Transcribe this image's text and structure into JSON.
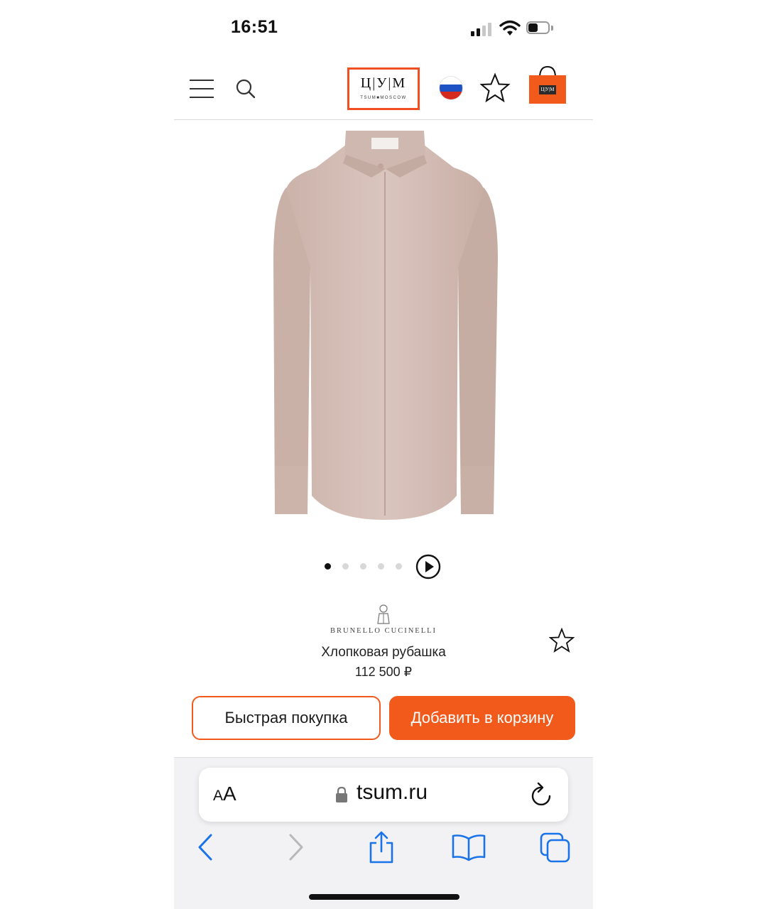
{
  "status_bar": {
    "time": "16:51"
  },
  "header": {
    "logo_main": "Ц|У|М",
    "logo_sub": "TSUM■MOSCOW",
    "bag_logo": "Ц|У|М",
    "accent_color": "#f25a1c"
  },
  "gallery": {
    "image_count": 5,
    "active_index": 0
  },
  "product": {
    "brand": "BRUNELLO CUCINELLI",
    "title": "Хлопковая рубашка",
    "price": "112 500 ₽"
  },
  "actions": {
    "quick_buy": "Быстрая покупка",
    "add_to_cart": "Добавить в корзину"
  },
  "browser": {
    "aa_small": "A",
    "aa_big": "A",
    "url": "tsum.ru"
  },
  "icons": [
    "menu-icon",
    "search-icon",
    "flag-icon",
    "star-icon",
    "bag-icon",
    "play-icon",
    "lock-icon",
    "reload-icon",
    "back-icon",
    "forward-icon",
    "share-icon",
    "bookmarks-icon",
    "tabs-icon"
  ]
}
